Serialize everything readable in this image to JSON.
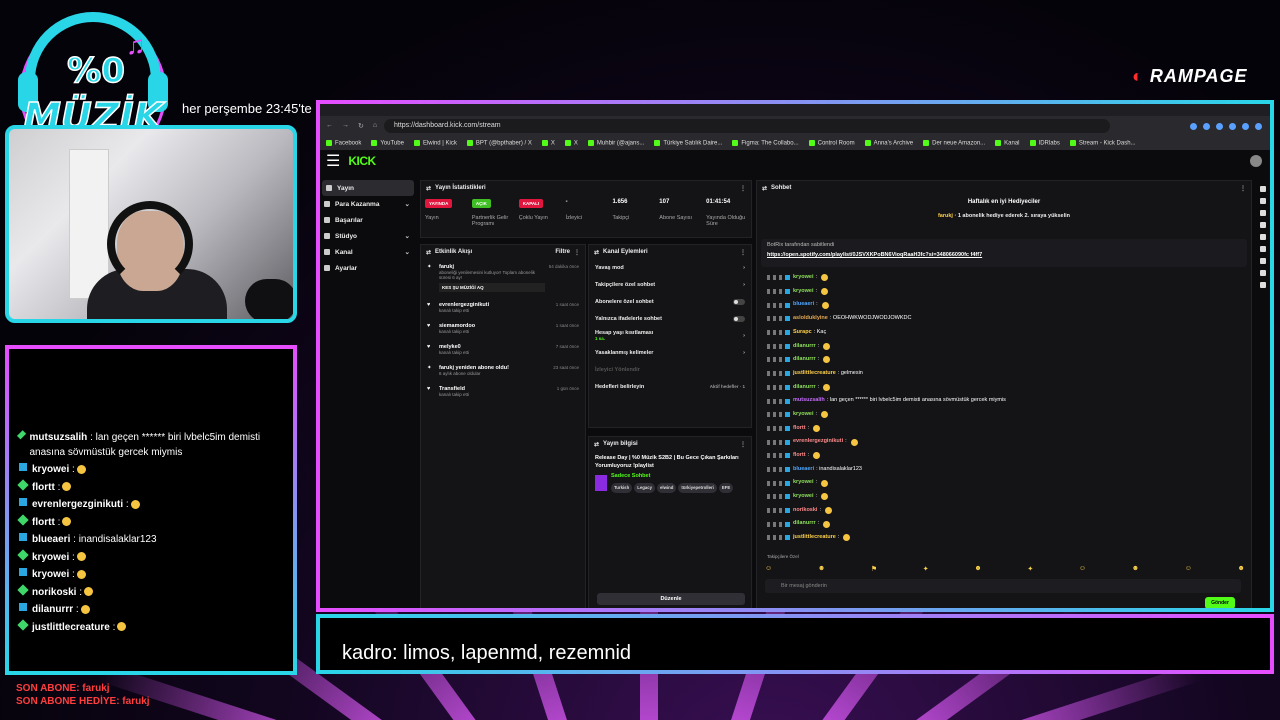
{
  "overlay": {
    "logo_text": "%0 MÜZİK",
    "schedule": "her perşembe 23:45'te",
    "sponsor": "RAMPAGE",
    "caption": "kadro: limos, lapenmd, rezemnid",
    "last_sub": "SON ABONE: farukj",
    "last_gift": "SON ABONE HEDİYE: farukj",
    "colors": {
      "pink": "#e64dff",
      "cyan": "#29d6e8",
      "kick_green": "#53fc18"
    }
  },
  "overlay_chat": [
    {
      "user": "mutsuzsalih",
      "text": ": lan geçen ****** biri lvbelc5im demisti anasına sövmüstük gercek miymis"
    },
    {
      "user": "kryowei",
      "text": ":"
    },
    {
      "user": "flortt",
      "text": ":"
    },
    {
      "user": "evrenlergezginikuti",
      "text": ":"
    },
    {
      "user": "flortt",
      "text": ":"
    },
    {
      "user": "blueaeri",
      "text": ": inandisalaklar123"
    },
    {
      "user": "kryowei",
      "text": ":"
    },
    {
      "user": "kryowei",
      "text": ":"
    },
    {
      "user": "norikoski",
      "text": ":"
    },
    {
      "user": "dilanurrr",
      "text": ":"
    },
    {
      "user": "justlittlecreature",
      "text": ":"
    }
  ],
  "browser": {
    "url": "https://dashboard.kick.com/stream",
    "bookmarks": [
      "Facebook",
      "YouTube",
      "Elwind | Kick",
      "BPT (@bpthaber) / X",
      "X",
      "X",
      "Muhbir (@ajans...",
      "Türkiye Satılık Daire...",
      "Figma: The Collabo...",
      "Control Room",
      "Anna's Archive",
      "Der neue Amazon...",
      "Kanal",
      "IDRlabs",
      "Stream - Kick Dash..."
    ]
  },
  "dashboard": {
    "logo": "KICK",
    "sidebar": [
      {
        "label": "Yayın"
      },
      {
        "label": "Para Kazanma"
      },
      {
        "label": "Başarılar"
      },
      {
        "label": "Stüdyo"
      },
      {
        "label": "Kanal"
      },
      {
        "label": "Ayarlar"
      }
    ],
    "stats": {
      "title": "Yayın İstatistikleri",
      "items": [
        {
          "tag": "YAYINDA",
          "label": "Yayın",
          "tag_color": "#e0163e"
        },
        {
          "tag": "AÇIK",
          "label": "Partnerlik Gelir Programı",
          "tag_color": "#3fbf23"
        },
        {
          "tag": "KAPALI",
          "label": "Çoklu Yayın",
          "tag_color": "#e0163e"
        },
        {
          "value": "-",
          "label": "İzleyici"
        },
        {
          "value": "1.656",
          "label": "Takipçi"
        },
        {
          "value": "107",
          "label": "Abone Sayısı"
        },
        {
          "value": "01:41:54",
          "label": "Yayında Olduğu Süre"
        }
      ]
    },
    "events": {
      "title": "Etkinlik Akışı",
      "filter": "Filtre",
      "items": [
        {
          "user": "farukj",
          "desc": "aboneliği yenilemesini kutluyor! Toplam abonelik süresi 6 ay!",
          "note": "KES ŞU MÜZİĞİ AQ",
          "time": "54 dakika önce"
        },
        {
          "user": "evrenlergezginikuti",
          "desc": "kanalı takip etti",
          "time": "1 saat önce"
        },
        {
          "user": "siemamordoo",
          "desc": "kanalı takip etti",
          "time": "1 saat önce"
        },
        {
          "user": "melyke0",
          "desc": "kanalı takip etti",
          "time": "7 saat önce"
        },
        {
          "user": "farukj yeniden abone oldu!",
          "desc": "6 aylık abone oldular",
          "time": "23 saat önce"
        },
        {
          "user": "Transfield",
          "desc": "kanalı takip etti",
          "time": "1 gün önce"
        }
      ]
    },
    "actions": {
      "title": "Kanal Eylemleri",
      "items": [
        {
          "label": "Yavaş mod",
          "kind": "chevron"
        },
        {
          "label": "Takipçilere özel sohbet",
          "kind": "chevron"
        },
        {
          "label": "Abonelere özel sohbet",
          "kind": "toggle"
        },
        {
          "label": "Yalnızca ifadelerle sohbet",
          "kind": "toggle"
        },
        {
          "label": "Hesap yaşı kısıtlaması",
          "sub": "1 sa.",
          "kind": "chevron"
        },
        {
          "label": "Yasaklanmış kelimeler",
          "kind": "chevron"
        },
        {
          "label": "İzleyici Yönlendir",
          "kind": "none"
        },
        {
          "label": "Hedefleri belirleyin",
          "kind": "goal",
          "extra": "Aktif hedefler · 1"
        }
      ]
    },
    "info": {
      "title": "Yayın bilgisi",
      "stream_title": "Release Day | %0 Müzik S2B2 | Bu Gece Çıkan Şarkıları Yorumluyoruz !playlist",
      "category": "Sadece Sohbet",
      "tags": [
        "Turkish",
        "Legacy",
        "elwind",
        "türkiyepetrolleri",
        "EFE"
      ],
      "edit": "Düzenle"
    },
    "chat": {
      "title": "Sohbet",
      "gifts_title": "Haftalık en iyi Hediyeciler",
      "gift_user": "farukj",
      "gift_text": "1 abonelik hediye ederek 2. sıraya yükselin",
      "pinned_by": "BotRix tarafından sabitlendi",
      "pinned_link": "https://open.spotify.com/playlist/0JSVXKPoBN6VioqRaaH3fc?si=348066090fc f4ff7",
      "messages": [
        {
          "user": "kryowei",
          "text": ":",
          "color": "#8ee05a"
        },
        {
          "user": "kryowei",
          "text": ":",
          "color": "#8ee05a"
        },
        {
          "user": "blueaeri",
          "text": ":",
          "color": "#4ea8ff"
        },
        {
          "user": "aslolduklyine",
          "text": ": OEOHWKWODJWODJOWKDC",
          "color": "#e4a84f"
        },
        {
          "user": "Surapc",
          "text": ": Kaç",
          "color": "#ffd24a"
        },
        {
          "user": "dilanurrr",
          "text": ":",
          "color": "#8ee05a"
        },
        {
          "user": "dilanurrr",
          "text": ":",
          "color": "#8ee05a"
        },
        {
          "user": "justlittlecreature",
          "text": ": gelmesin",
          "color": "#ffd24a"
        },
        {
          "user": "dilanurrr",
          "text": ":",
          "color": "#8ee05a"
        },
        {
          "user": "mutsuzsalih",
          "text": ": lan geçen ****** biri lvbelc5im demisti anasına sövmüstük gercek miymis",
          "color": "#c86bff"
        },
        {
          "user": "kryowei",
          "text": ":",
          "color": "#8ee05a"
        },
        {
          "user": "flortt",
          "text": ":",
          "color": "#ff8a8a"
        },
        {
          "user": "evrenlergezginikuti",
          "text": ":",
          "color": "#ff8a8a"
        },
        {
          "user": "flortt",
          "text": ":",
          "color": "#ff8a8a"
        },
        {
          "user": "blueaeri",
          "text": ": inandisalaklar123",
          "color": "#4ea8ff"
        },
        {
          "user": "kryowei",
          "text": ":",
          "color": "#8ee05a"
        },
        {
          "user": "kryowei",
          "text": ":",
          "color": "#8ee05a"
        },
        {
          "user": "norikoski",
          "text": ":",
          "color": "#ff8a8a"
        },
        {
          "user": "dilanurrr",
          "text": ":",
          "color": "#8ee05a"
        },
        {
          "user": "justlittlecreature",
          "text": ":",
          "color": "#ffd24a"
        }
      ],
      "followers_only": "Takipçilere Özel",
      "input_placeholder": "Bir mesaj gönderin",
      "send": "Gönder"
    }
  }
}
